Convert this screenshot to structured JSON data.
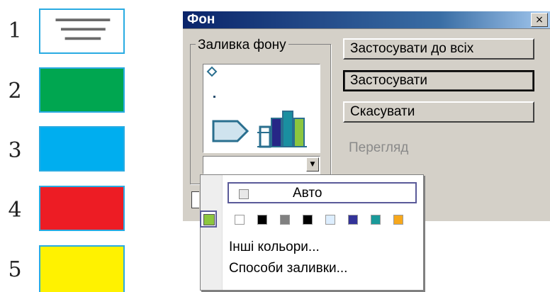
{
  "legend": {
    "items": [
      {
        "number": "1",
        "color": "#ffffff",
        "icon": "text-lines-icon"
      },
      {
        "number": "2",
        "color": "#00a650"
      },
      {
        "number": "3",
        "color": "#00aeef"
      },
      {
        "number": "4",
        "color": "#ed1c24"
      },
      {
        "number": "5",
        "color": "#fff200"
      }
    ]
  },
  "dialog": {
    "title": "Фон",
    "close_glyph": "×",
    "group_label": "Заливка фону",
    "combo_arrow": "▼",
    "buttons": {
      "apply_all": "Застосувати до всіх",
      "apply": "Застосувати",
      "cancel": "Скасувати",
      "preview": "Перегляд"
    }
  },
  "popup": {
    "auto_label": "Авто",
    "colors": [
      "#ffffff",
      "#000000",
      "#808080",
      "#000000",
      "#ddeeff",
      "#333399",
      "#1a9a9a",
      "#f7a81c",
      "#8cc63f"
    ],
    "more_colors": "Інші кольори...",
    "fill_effects": "Способи заливки..."
  }
}
